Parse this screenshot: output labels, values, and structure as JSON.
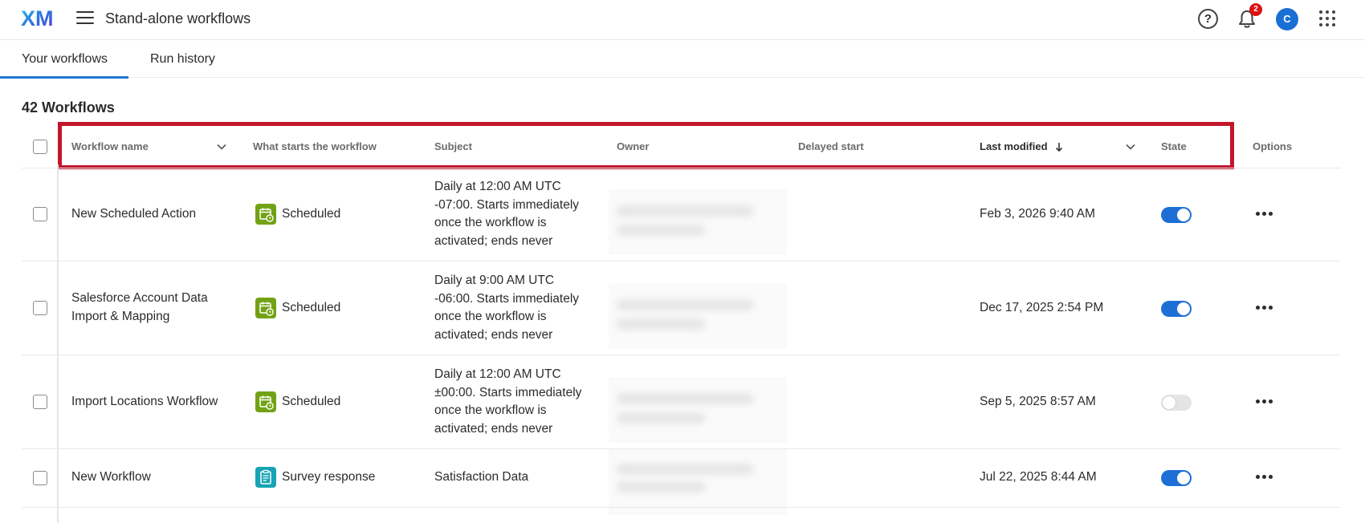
{
  "topbar": {
    "logo_text": "XM",
    "title": "Stand-alone workflows",
    "help_glyph": "?",
    "notifications_count": "2",
    "avatar_initial": "C"
  },
  "tabs": [
    {
      "label": "Your workflows",
      "active": true
    },
    {
      "label": "Run history",
      "active": false
    }
  ],
  "summary": {
    "count_label": "42 Workflows"
  },
  "table": {
    "columns": {
      "name": "Workflow name",
      "trigger": "What starts the workflow",
      "subject": "Subject",
      "owner": "Owner",
      "delayed": "Delayed start",
      "modified": "Last modified",
      "state": "State",
      "options": "Options"
    },
    "rows": [
      {
        "name": "New Scheduled Action",
        "trigger": "Scheduled",
        "trigger_icon": "calendar-clock-icon",
        "subject_lines": [
          "Daily at 12:00 AM UTC",
          "-07:00. Starts immediately",
          "once the workflow is",
          "activated; ends never"
        ],
        "last_modified": "Feb 3, 2026 9:40 AM",
        "state_on": true
      },
      {
        "name": "Salesforce Account Data Import & Mapping",
        "name_lines": [
          "Salesforce Account Data",
          "Import & Mapping"
        ],
        "trigger": "Scheduled",
        "trigger_icon": "calendar-clock-icon",
        "subject_lines": [
          "Daily at 9:00 AM UTC",
          "-06:00. Starts immediately",
          "once the workflow is",
          "activated; ends never"
        ],
        "last_modified": "Dec 17, 2025 2:54 PM",
        "state_on": true
      },
      {
        "name": "Import Locations Workflow",
        "trigger": "Scheduled",
        "trigger_icon": "calendar-clock-icon",
        "subject_lines": [
          "Daily at 12:00 AM UTC",
          "±00:00. Starts immediately",
          "once the workflow is",
          "activated; ends never"
        ],
        "last_modified": "Sep 5, 2025 8:57 AM",
        "state_on": false
      },
      {
        "name": "New Workflow",
        "trigger": "Survey response",
        "trigger_icon": "clipboard-icon",
        "subject": "Satisfaction Data",
        "last_modified": "Jul 22, 2025 8:44 AM",
        "state_on": true
      }
    ]
  },
  "colors": {
    "accent": "#2176d2",
    "highlight": "#c3162a",
    "scheduled": "#72a215",
    "survey": "#18a4b4"
  }
}
